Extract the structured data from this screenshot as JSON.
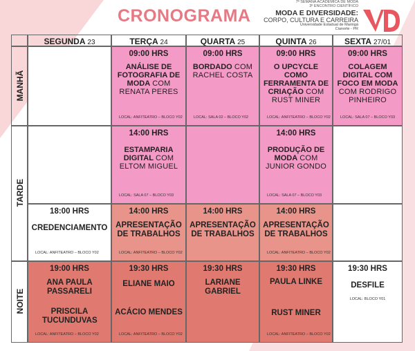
{
  "title": "CRONOGRAMA",
  "brand": {
    "line1": "7ª SEMANA ACADÊMICA DE MODA",
    "line2": "3º ENCONTRO CIENTÍFICO",
    "line3": "MODA E DIVERSIDADE:",
    "line4": "CORPO, CULTURA E CARREIRA",
    "line5": "Universidade Estadual de Maringá",
    "line6": "Cianorte - PR"
  },
  "days": [
    {
      "name": "SEGUNDA",
      "num": "23"
    },
    {
      "name": "TERÇA",
      "num": "24"
    },
    {
      "name": "QUARTA",
      "num": "25"
    },
    {
      "name": "QUINTA",
      "num": "26"
    },
    {
      "name": "SEXTA",
      "num": "27/01"
    }
  ],
  "periods": [
    "MANHÃ",
    "TARDE",
    "NOITE"
  ],
  "manha": {
    "terca": {
      "time": "09:00 HRS",
      "bold": "ANÁLISE DE FOTOGRAFIA DE MODA",
      "light": "COM RENATA PERES",
      "loc": "LOCAL: ANFITEATRO – BLOCO Y02"
    },
    "quarta": {
      "time": "09:00 HRS",
      "bold": "BORDADO",
      "light": "COM RACHEL COSTA",
      "loc": "LOCAL: SALA 02 – BLOCO Y02"
    },
    "quinta": {
      "time": "09:00 HRS",
      "bold": "O UPCYCLE COMO FERRAMENTA DE CRIAÇÃO",
      "light": "COM RUST MINER",
      "loc": "LOCAL: ANFITEATRO – BLOCO Y02"
    },
    "sexta": {
      "time": "09:00 HRS",
      "bold": "COLAGEM DIGITAL COM FOCO EM MODA",
      "light": "COM RODRIGO PINHEIRO",
      "loc": "LOCAL: SALA 07 – BLOCO Y03"
    }
  },
  "tarde": {
    "terca": {
      "time": "14:00 HRS",
      "bold": "ESTAMPARIA DIGITAL",
      "light": "COM ELTOM MIGUEL",
      "loc": "LOCAL: SALA 07 – BLOCO Y03"
    },
    "quinta": {
      "time": "14:00 HRS",
      "bold": "PRODUÇÃO DE MODA",
      "light": "COM JUNIOR GONDO",
      "loc": "LOCAL: SALA 07 – BLOCO Y03"
    },
    "segunda2": {
      "time": "18:00 HRS",
      "text": "CREDENCIAMENTO",
      "loc": "LOCAL: ANFITEATRO – BLOCO Y02"
    },
    "terca2": {
      "time": "14:00 HRS",
      "text": "APRESENTAÇÃO DE TRABALHOS",
      "loc": "LOCAL: ANFITEATRO – BLOCO Y02"
    },
    "quarta2": {
      "time": "14:00 HRS",
      "text": "APRESENTAÇÃO DE TRABALHOS"
    },
    "quinta2": {
      "time": "14:00 HRS",
      "text": "APRESENTAÇÃO DE TRABALHOS",
      "loc": "LOCAL: ANFITEATRO – BLOCO Y02"
    }
  },
  "noite": {
    "segunda": {
      "time": "19:00 HRS",
      "name1": "ANA PAULA PASSARELI",
      "name2": "PRISCILA TUCUNDUVAS",
      "loc": "LOCAL: ANFITEATRO – BLOCO Y02"
    },
    "terca": {
      "time": "19:30 HRS",
      "name1": "ELIANE MAIO",
      "name2": "ACÁCIO MENDES",
      "loc": "LOCAL: ANFITEATRO – BLOCO Y02"
    },
    "quarta": {
      "time": "19:30 HRS",
      "name1": "LARIANE GABRIEL"
    },
    "quinta": {
      "time": "19:30 HRS",
      "name1": "PAULA LINKE",
      "name2": "RUST MINER",
      "loc": "LOCAL: ANFITEATRO – BLOCO Y02"
    },
    "sexta": {
      "time": "19:30 HRS",
      "name1": "DESFILE",
      "loc": "LOCAL: BLOCO Y01"
    }
  },
  "colors": {
    "pink": "#f49ac6",
    "salmon": "#e8948a",
    "red": "#e07a70",
    "title": "#e67a84",
    "logo": "#e8565f"
  }
}
